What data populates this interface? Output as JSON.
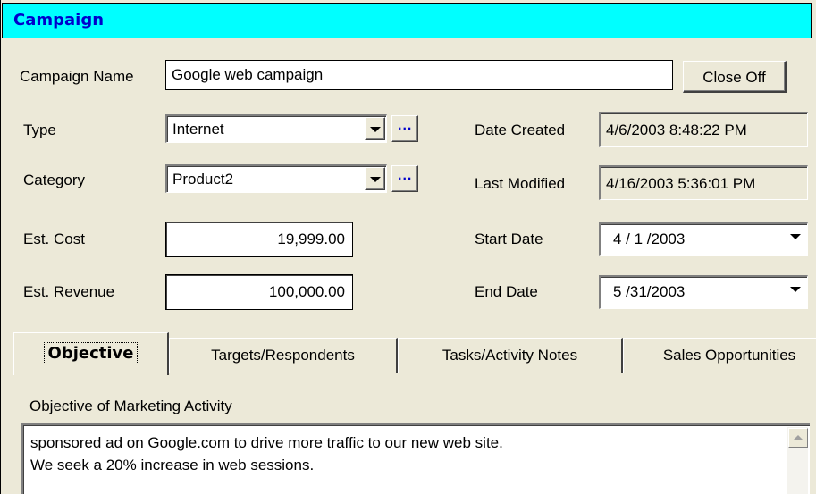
{
  "title": "Campaign",
  "campaign_name": {
    "label": "Campaign Name",
    "value": "Google web campaign"
  },
  "close_off": {
    "label": "Close Off"
  },
  "type": {
    "label": "Type",
    "value": "Internet",
    "lookup": "..."
  },
  "category": {
    "label": "Category",
    "value": "Product2",
    "lookup": "..."
  },
  "date_created": {
    "label": "Date Created",
    "value": "4/6/2003 8:48:22 PM"
  },
  "last_modified": {
    "label": "Last Modified",
    "value": "4/16/2003 5:36:01 PM"
  },
  "est_cost": {
    "label": "Est. Cost",
    "value": "19,999.00"
  },
  "est_revenue": {
    "label": "Est. Revenue",
    "value": "100,000.00"
  },
  "start_date": {
    "label": "Start Date",
    "value": "4 / 1 /2003"
  },
  "end_date": {
    "label": "End Date",
    "value": "5 /31/2003"
  },
  "tabs": [
    {
      "label": "Objective",
      "active": true
    },
    {
      "label": "Targets/Respondents"
    },
    {
      "label": "Tasks/Activity Notes"
    },
    {
      "label": "Sales Opportunities"
    }
  ],
  "objective": {
    "label": "Objective of Marketing Activity",
    "lines": [
      "sponsored ad on Google.com to drive more traffic to our new web site.",
      "We seek a 20% increase in web sessions."
    ]
  },
  "colors": {
    "title_bar": "#00FFFF",
    "title_text": "#0000CC",
    "face": "#ECE9D8"
  }
}
